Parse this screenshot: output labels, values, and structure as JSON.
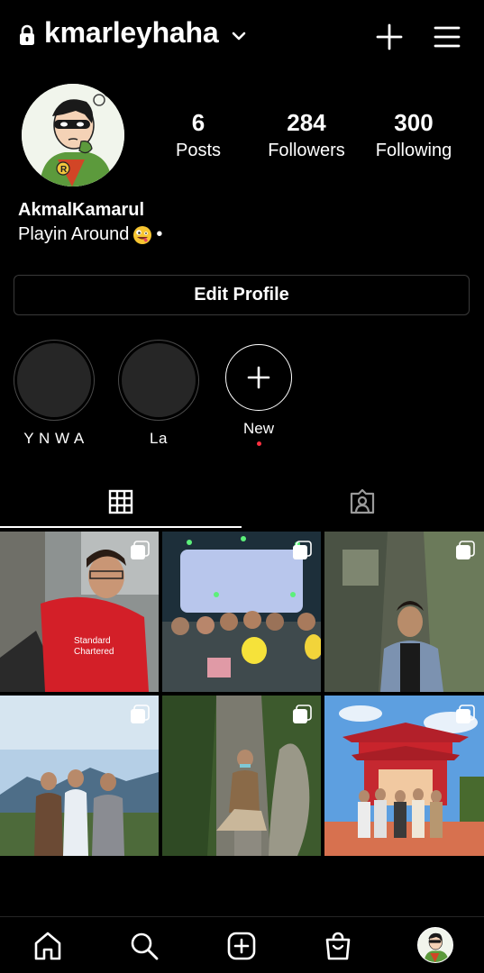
{
  "header": {
    "username": "kmarleyhaha",
    "icons": [
      "lock-icon",
      "chevron-down-icon",
      "plus-icon",
      "menu-icon"
    ]
  },
  "profile": {
    "stats": {
      "posts": {
        "value": "6",
        "label": "Posts"
      },
      "followers": {
        "value": "284",
        "label": "Followers"
      },
      "following": {
        "value": "300",
        "label": "Following"
      }
    },
    "display_name": "AkmalKamarul",
    "bio": "Playin Around",
    "bio_suffix": "•",
    "bio_emoji": "zany-face-emoji",
    "edit_button": "Edit Profile"
  },
  "highlights": [
    {
      "label": "Y N W A"
    },
    {
      "label": "La"
    },
    {
      "label": "New"
    }
  ],
  "tabs": [
    {
      "icon": "grid-icon",
      "active": true
    },
    {
      "icon": "tagged-icon",
      "active": false
    }
  ],
  "posts_grid": {
    "count": 6,
    "multi_photo_badge": true
  },
  "bottom_nav": [
    {
      "icon": "home-icon"
    },
    {
      "icon": "search-icon"
    },
    {
      "icon": "create-icon"
    },
    {
      "icon": "shop-icon"
    },
    {
      "icon": "profile-avatar"
    }
  ],
  "colors": {
    "background": "#000000",
    "text": "#ffffff",
    "border": "#3a3a3a",
    "notification_dot": "#ff3040"
  }
}
